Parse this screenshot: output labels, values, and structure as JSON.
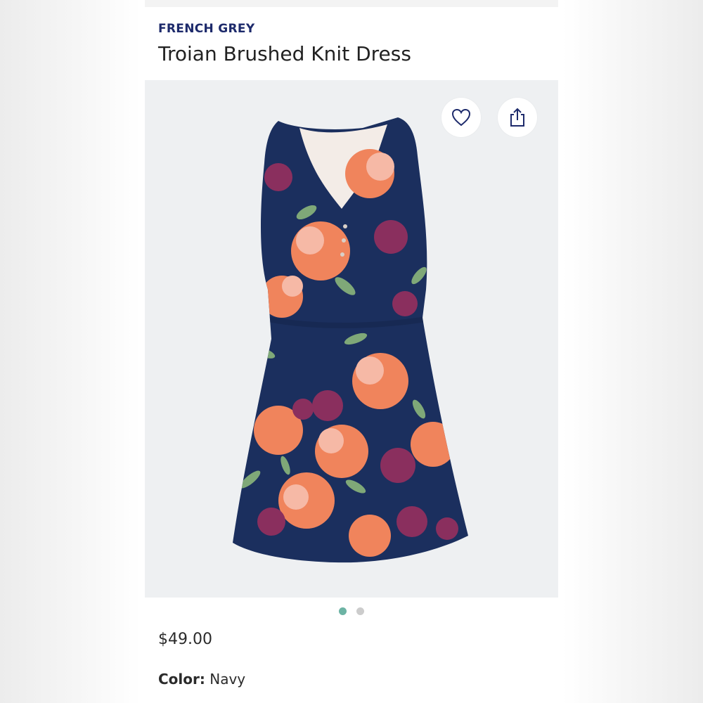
{
  "product": {
    "brand": "FRENCH GREY",
    "name": "Troian Brushed Knit Dress",
    "price": "$49.00",
    "color_label": "Color:",
    "color_value": "Navy"
  },
  "image": {
    "subject": "dress-image",
    "actions": [
      {
        "name": "favorite",
        "icon": "heart-icon"
      },
      {
        "name": "share",
        "icon": "share-icon"
      }
    ]
  },
  "carousel": {
    "page_count": 2,
    "active_index": 0,
    "active_color": "#6cb3a4",
    "inactive_color": "#cccccc"
  },
  "colors": {
    "brand": "#1d2a6b",
    "text": "#222222",
    "image_bg": "#eef0f2",
    "dress_navy": "#1b2f5e",
    "flower_coral": "#f0845c",
    "flower_pink": "#f6b9a6",
    "flower_magenta": "#8a2f5e",
    "leaf_green": "#7fa878"
  }
}
